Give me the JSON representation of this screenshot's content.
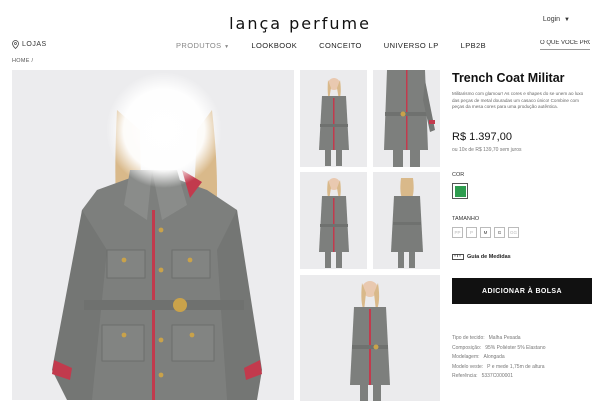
{
  "header": {
    "logo": "lança perfume",
    "login": "Login",
    "lojas": "LOJAS",
    "search_placeholder": "O QUE VOCÊ PROC"
  },
  "nav": {
    "items": [
      {
        "label": "PRODUTOS",
        "dropdown": true
      },
      {
        "label": "LOOKBOOK"
      },
      {
        "label": "CONCEITO"
      },
      {
        "label": "UNIVERSO LP"
      },
      {
        "label": "LPB2B"
      }
    ]
  },
  "breadcrumb": "HOME /",
  "product": {
    "title": "Trench Coat Militar",
    "description": "Militarismo com glamour! As cores e shapes do se unem ao luxo das peças de metal douradas um casaco único! Combine com peças da mesa cores para uma produção autêntica.",
    "price": "R$ 1.397,00",
    "installments": "ou 10x de R$ 139,70 sem juros",
    "color_label": "COR",
    "color_hex": "#2e9c4f",
    "size_label": "TAMANHO",
    "sizes": [
      "PP",
      "P",
      "M",
      "G",
      "GG"
    ],
    "size_guide": "Guia de Medidas",
    "add_to_bag": "ADICIONAR À BOLSA",
    "specs": [
      {
        "key": "Tipo de tecido:",
        "value": "Malha Pesada"
      },
      {
        "key": "Composição:",
        "value": "95% Poliéster 5% Elastano"
      },
      {
        "key": "Modelagem:",
        "value": "Alongada"
      },
      {
        "key": "Modelo veste:",
        "value": "P e mede 1,75m de altura"
      },
      {
        "key": "Referência:",
        "value": "5337C000001"
      }
    ]
  },
  "colors": {
    "coat": "#7d7f7d",
    "trim": "#c23a4d",
    "buttons": "#c9a24a",
    "hair": "#d9b98a"
  }
}
